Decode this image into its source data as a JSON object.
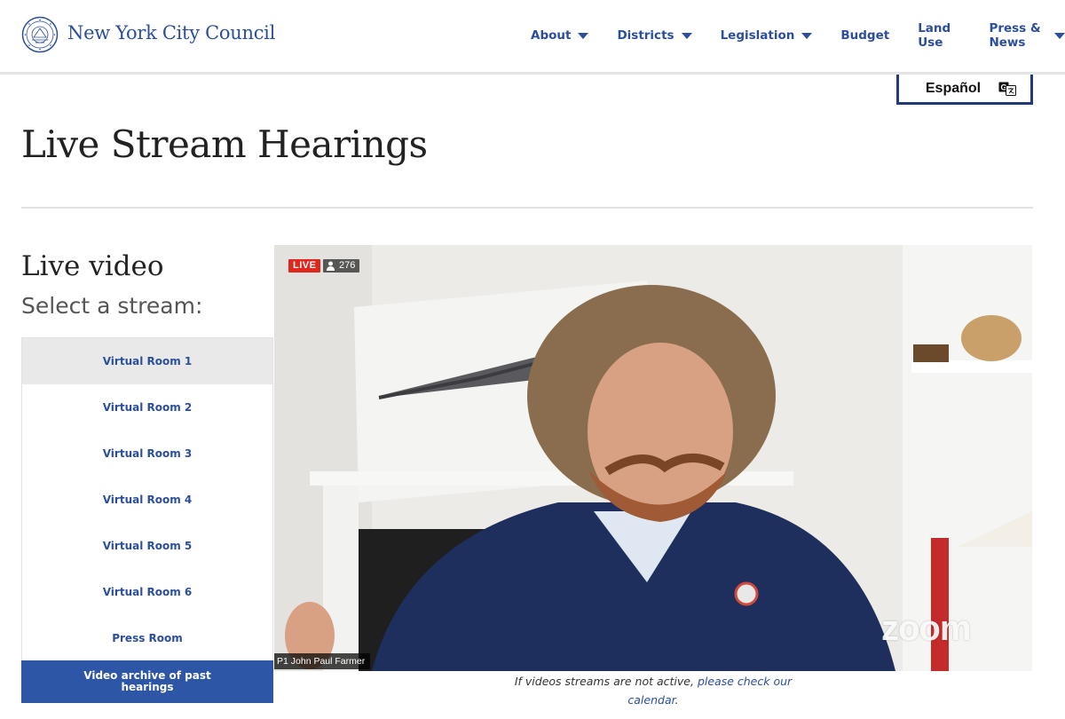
{
  "header": {
    "logo_text": "New York City Council",
    "nav": [
      {
        "label": "About",
        "has_dropdown": true
      },
      {
        "label": "Districts",
        "has_dropdown": true
      },
      {
        "label": "Legislation",
        "has_dropdown": true
      },
      {
        "label": "Budget",
        "has_dropdown": false
      },
      {
        "label": "Land Use",
        "has_dropdown": false
      },
      {
        "label": "Press & News",
        "has_dropdown": true
      }
    ]
  },
  "language": {
    "label": "Español",
    "icon": "translate-icon"
  },
  "page": {
    "title": "Live Stream Hearings"
  },
  "sidebar": {
    "heading": "Live video",
    "subheading": "Select a stream:",
    "streams": [
      {
        "label": "Virtual Room 1",
        "active": true
      },
      {
        "label": "Virtual Room 2",
        "active": false
      },
      {
        "label": "Virtual Room 3",
        "active": false
      },
      {
        "label": "Virtual Room 4",
        "active": false
      },
      {
        "label": "Virtual Room 5",
        "active": false
      },
      {
        "label": "Virtual Room 6",
        "active": false
      },
      {
        "label": "Press Room",
        "active": false
      }
    ],
    "archive_label": "Video archive of past hearings"
  },
  "video": {
    "live_label": "LIVE",
    "viewer_count": "276",
    "watermark": "zoom",
    "speaker_name": "P1 John Paul Farmer"
  },
  "caption": {
    "text": "If videos streams are not active,",
    "link_text": "please check our calendar",
    "suffix": "."
  },
  "colors": {
    "brand_blue": "#2b4f9c",
    "archive_blue": "#2d56a6",
    "live_red": "#e0271d"
  }
}
